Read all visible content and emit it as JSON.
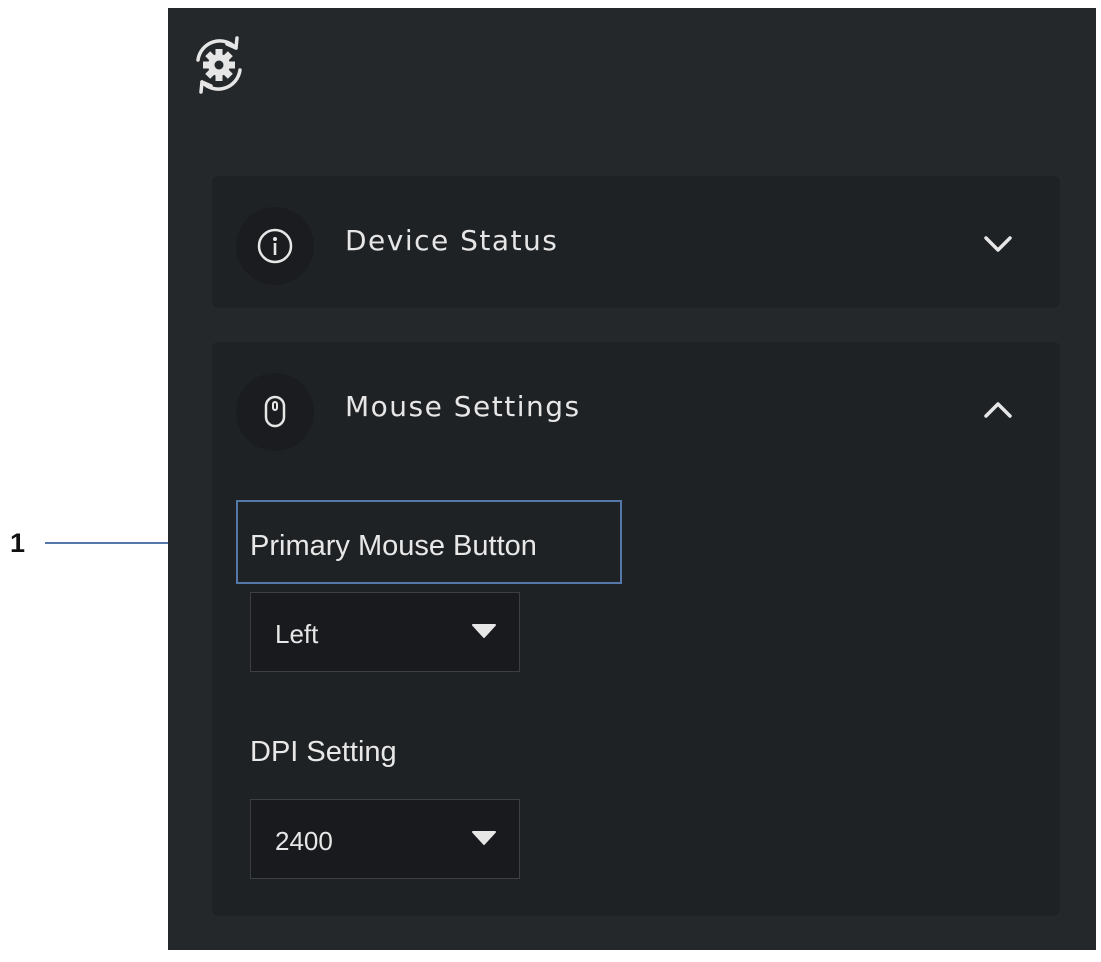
{
  "callout": {
    "number": "1"
  },
  "toolbar": {
    "app_icon": "gear-sync-icon"
  },
  "sections": {
    "device_status": {
      "title": "Device Status",
      "icon": "info-icon",
      "expanded": false,
      "toggle_icon": "chevron-down-icon"
    },
    "mouse_settings": {
      "title": "Mouse Settings",
      "icon": "mouse-icon",
      "expanded": true,
      "toggle_icon": "chevron-up-icon",
      "primary_button": {
        "label": "Primary Mouse Button",
        "value": "Left"
      },
      "dpi": {
        "label": "DPI Setting",
        "value": "2400"
      }
    }
  },
  "colors": {
    "panel_background": "#25282b",
    "section_background": "#1f2225",
    "text": "#e6e6e6",
    "callout_accent": "#5577aa"
  }
}
